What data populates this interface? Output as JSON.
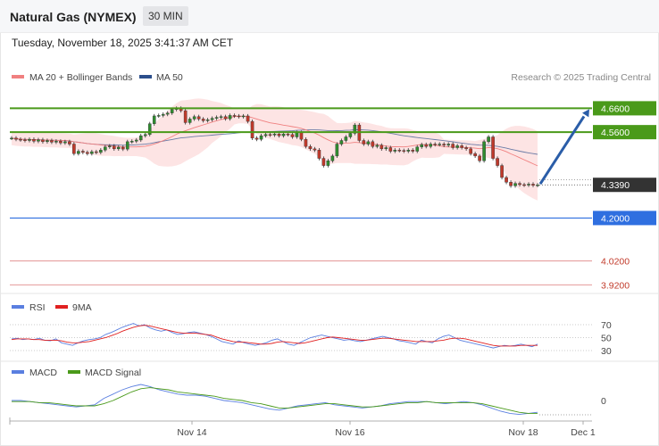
{
  "header": {
    "title": "Natural Gas (NYMEX)",
    "timeframe": "30 MIN",
    "datetime": "Tuesday, November 18, 2025 3:41:37 AM CET"
  },
  "legend": {
    "ma20": "MA 20 + Bollinger Bands",
    "ma50": "MA 50",
    "credit": "Research © 2025 Trading Central",
    "rsi": "RSI",
    "rsi_ma": "9MA",
    "macd": "MACD",
    "macd_signal": "MACD Signal"
  },
  "colors": {
    "resistance": "#4a9a1a",
    "support": "#2f6fe0",
    "minor_support": "#e08a8a",
    "current": "#333333",
    "arrow": "#2a5da8",
    "ma20": "#f08080",
    "ma50": "#2c4f8c",
    "bollinger_fill": "#fde4e4",
    "rsi": "#5a7fe0",
    "rsi_ma": "#e02020",
    "macd": "#5a7fe0",
    "macd_signal": "#4a9a1a"
  },
  "chart_data": [
    {
      "type": "candlestick",
      "name": "price",
      "ylim": [
        3.88,
        4.74
      ],
      "x_labels": [
        "Nov 14",
        "Nov 16",
        "Nov 18",
        "Dec 1"
      ],
      "levels": [
        {
          "value": 4.66,
          "label": "4.6600",
          "kind": "resistance"
        },
        {
          "value": 4.56,
          "label": "4.5600",
          "kind": "resistance"
        },
        {
          "value": 4.339,
          "label": "4.3390",
          "kind": "current"
        },
        {
          "value": 4.2,
          "label": "4.2000",
          "kind": "support"
        },
        {
          "value": 4.02,
          "label": "4.0200",
          "kind": "minor"
        },
        {
          "value": 3.92,
          "label": "3.9200",
          "kind": "minor"
        }
      ],
      "close": [
        4.535,
        4.53,
        4.528,
        4.525,
        4.53,
        4.522,
        4.528,
        4.52,
        4.525,
        4.518,
        4.522,
        4.515,
        4.52,
        4.51,
        4.47,
        4.48,
        4.475,
        4.47,
        4.478,
        4.475,
        4.485,
        4.498,
        4.502,
        4.49,
        4.497,
        4.489,
        4.52,
        4.522,
        4.527,
        4.545,
        4.55,
        4.595,
        4.628,
        4.63,
        4.635,
        4.64,
        4.655,
        4.66,
        4.65,
        4.6,
        4.615,
        4.625,
        4.615,
        4.608,
        4.612,
        4.618,
        4.622,
        4.625,
        4.616,
        4.63,
        4.628,
        4.625,
        4.628,
        4.605,
        4.535,
        4.53,
        4.545,
        4.55,
        4.548,
        4.552,
        4.545,
        4.552,
        4.55,
        4.54,
        4.558,
        4.53,
        4.5,
        4.49,
        4.485,
        4.45,
        4.42,
        4.44,
        4.46,
        4.51,
        4.525,
        4.54,
        4.555,
        4.59,
        4.525,
        4.51,
        4.52,
        4.5,
        4.505,
        4.49,
        4.495,
        4.48,
        4.485,
        4.483,
        4.48,
        4.485,
        4.48,
        4.498,
        4.508,
        4.5,
        4.51,
        4.508,
        4.51,
        4.505,
        4.51,
        4.495,
        4.503,
        4.495,
        4.49,
        4.47,
        4.46,
        4.44,
        4.52,
        4.54,
        4.45,
        4.42,
        4.37,
        4.35,
        4.335,
        4.345,
        4.34,
        4.338,
        4.342,
        4.337,
        4.339
      ],
      "ma20_last": 4.36,
      "ma50_last": 4.44,
      "bollinger_last": [
        4.3,
        4.48
      ],
      "forecast": {
        "from": 4.339,
        "to": 4.66
      }
    },
    {
      "type": "line",
      "name": "rsi",
      "yticks": [
        70,
        50,
        30
      ],
      "series": [
        {
          "name": "RSI",
          "values": [
            48,
            49,
            47,
            48,
            47,
            49,
            46,
            45,
            48,
            42,
            40,
            38,
            42,
            45,
            47,
            48,
            50,
            55,
            58,
            62,
            66,
            69,
            72,
            68,
            70,
            65,
            62,
            60,
            62,
            58,
            55,
            56,
            58,
            59,
            57,
            55,
            52,
            48,
            44,
            42,
            40,
            45,
            42,
            40,
            38,
            40,
            42,
            46,
            48,
            44,
            40,
            38,
            42,
            46,
            50,
            52,
            54,
            52,
            50,
            48,
            46,
            47,
            45,
            44,
            46,
            48,
            50,
            52,
            50,
            48,
            45,
            44,
            42,
            40,
            46,
            44,
            42,
            48,
            52,
            54,
            50,
            46,
            44,
            42,
            40,
            38,
            36,
            34,
            36,
            38,
            37,
            38,
            40,
            38,
            36,
            40
          ]
        },
        {
          "name": "9MA",
          "values": [
            47,
            48,
            48,
            48,
            47,
            47,
            46,
            46,
            46,
            45,
            43,
            42,
            42,
            43,
            44,
            46,
            48,
            50,
            53,
            56,
            60,
            63,
            66,
            68,
            69,
            68,
            66,
            64,
            62,
            60,
            58,
            57,
            57,
            57,
            56,
            55,
            54,
            51,
            48,
            46,
            44,
            43,
            43,
            42,
            41,
            40,
            40,
            41,
            43,
            44,
            43,
            42,
            41,
            42,
            44,
            46,
            48,
            50,
            51,
            50,
            49,
            48,
            47,
            46,
            46,
            47,
            48,
            49,
            49,
            48,
            47,
            46,
            45,
            44,
            44,
            44,
            44,
            45,
            46,
            48,
            49,
            49,
            48,
            46,
            44,
            42,
            40,
            38,
            37,
            37,
            37,
            37,
            38,
            38,
            38,
            38
          ]
        }
      ]
    },
    {
      "type": "line",
      "name": "macd",
      "yticks": [
        0
      ],
      "series": [
        {
          "name": "MACD",
          "values": [
            0.0,
            0.0,
            -0.01,
            -0.02,
            -0.03,
            -0.04,
            -0.05,
            -0.06,
            -0.05,
            -0.04,
            0.02,
            0.06,
            0.1,
            0.13,
            0.15,
            0.13,
            0.1,
            0.08,
            0.06,
            0.05,
            0.05,
            0.04,
            0.02,
            0.0,
            -0.01,
            -0.02,
            -0.04,
            -0.06,
            -0.08,
            -0.09,
            -0.07,
            -0.05,
            -0.04,
            -0.03,
            -0.02,
            -0.04,
            -0.05,
            -0.06,
            -0.07,
            -0.06,
            -0.05,
            -0.03,
            -0.02,
            -0.01,
            -0.01,
            -0.01,
            -0.02,
            -0.03,
            -0.02,
            -0.01,
            -0.02,
            -0.04,
            -0.07,
            -0.1,
            -0.12,
            -0.13,
            -0.12,
            -0.11
          ]
        },
        {
          "name": "MACD Signal",
          "values": [
            -0.01,
            -0.01,
            -0.01,
            -0.02,
            -0.02,
            -0.03,
            -0.04,
            -0.05,
            -0.05,
            -0.05,
            -0.03,
            0.0,
            0.04,
            0.08,
            0.11,
            0.12,
            0.11,
            0.1,
            0.08,
            0.07,
            0.06,
            0.05,
            0.04,
            0.02,
            0.01,
            0.0,
            -0.02,
            -0.03,
            -0.05,
            -0.07,
            -0.07,
            -0.06,
            -0.05,
            -0.04,
            -0.03,
            -0.03,
            -0.04,
            -0.05,
            -0.06,
            -0.06,
            -0.05,
            -0.04,
            -0.03,
            -0.02,
            -0.02,
            -0.01,
            -0.02,
            -0.02,
            -0.02,
            -0.02,
            -0.02,
            -0.03,
            -0.05,
            -0.07,
            -0.09,
            -0.11,
            -0.12,
            -0.12
          ]
        }
      ]
    }
  ]
}
